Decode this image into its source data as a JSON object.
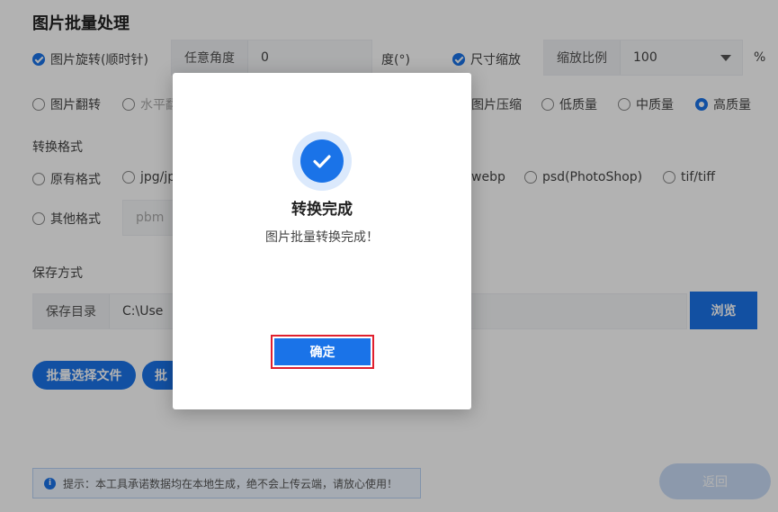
{
  "page": {
    "title": "图片批量处理"
  },
  "rotate": {
    "label": "图片旋转(顺时针)",
    "angle_label": "任意角度",
    "angle_value": "0",
    "unit": "度(°)"
  },
  "resize": {
    "label": "尺寸缩放",
    "ratio_label": "缩放比例",
    "ratio_value": "100",
    "unit": "%"
  },
  "flip": {
    "label": "图片翻转",
    "horizontal_label": "水平翻"
  },
  "compress": {
    "label": "图片压缩",
    "options": [
      "低质量",
      "中质量",
      "高质量"
    ],
    "selected": "高质量"
  },
  "format": {
    "section_label": "转换格式",
    "original_label": "原有格式",
    "jpg_label": "jpg/jp",
    "webp_label": "webp",
    "psd_label": "psd(PhotoShop)",
    "tif_label": "tif/tiff",
    "other_label": "其他格式",
    "other_placeholder": "pbm"
  },
  "save": {
    "section_label": "保存方式",
    "dir_label": "保存目录",
    "dir_value": "C:\\Use",
    "browse_label": "浏览"
  },
  "actions": {
    "batch_select_label": "批量选择文件",
    "batch_second_label": "批"
  },
  "tip": {
    "icon": "info-icon",
    "text": "提示：本工具承诺数据均在本地生成，绝不会上传云端，请放心使用！"
  },
  "return_label": "返回",
  "modal": {
    "icon": "check-circle-icon",
    "title": "转换完成",
    "message": "图片批量转换完成！",
    "ok_label": "确定"
  },
  "colors": {
    "accent": "#1a73e8",
    "highlight_border": "#e0202e"
  }
}
